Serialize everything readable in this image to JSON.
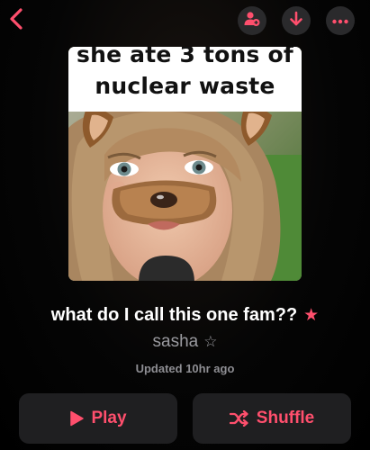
{
  "header": {
    "back_icon": "chevron-left-icon",
    "actions": [
      {
        "name": "add-person",
        "icon": "person-add-icon"
      },
      {
        "name": "download",
        "icon": "arrow-down-icon"
      },
      {
        "name": "more",
        "icon": "ellipsis-icon"
      }
    ]
  },
  "artwork": {
    "caption_line1": "she ate 3 tons of",
    "caption_line2": "nuclear waste"
  },
  "playlist": {
    "title": "what do I call this one fam??",
    "title_star": "★",
    "owner": "sasha",
    "owner_star": "☆",
    "updated": "Updated 10hr ago"
  },
  "buttons": {
    "play_label": "Play",
    "shuffle_label": "Shuffle"
  },
  "colors": {
    "accent": "#ff4f6d",
    "button_bg": "#1f1f21",
    "secondary_text": "#9a9a9f"
  }
}
